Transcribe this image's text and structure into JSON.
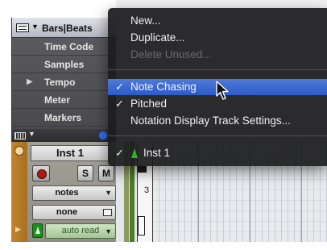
{
  "ruler": {
    "header_label": "Bars|Beats",
    "items": [
      {
        "label": "Time Code",
        "expandable": false
      },
      {
        "label": "Samples",
        "expandable": false
      },
      {
        "label": "Tempo",
        "expandable": true
      },
      {
        "label": "Meter",
        "expandable": false
      },
      {
        "label": "Markers",
        "expandable": false
      }
    ]
  },
  "track": {
    "name": "Inst 1",
    "solo_label": "S",
    "mute_label": "M",
    "view_selector": "notes",
    "playlist_selector": "none",
    "automation_mode": "auto read"
  },
  "timeline": {
    "ruler_number": "3"
  },
  "menu": {
    "items": [
      {
        "label": "New...",
        "checked": false,
        "enabled": true
      },
      {
        "label": "Duplicate...",
        "checked": false,
        "enabled": true
      },
      {
        "label": "Delete Unused...",
        "checked": false,
        "enabled": false
      },
      {
        "label": "Note Chasing",
        "checked": true,
        "enabled": true,
        "highlighted": true
      },
      {
        "label": "Pitched",
        "checked": true,
        "enabled": true
      },
      {
        "label": "Notation Display Track Settings...",
        "checked": false,
        "enabled": true
      },
      {
        "label": "Inst 1",
        "checked": true,
        "enabled": true,
        "icon": "midi-track-icon"
      }
    ],
    "check_glyph": "✓"
  },
  "colors": {
    "menu_bg": "#1c1c1e",
    "menu_highlight": "#3a66d0",
    "track_orange": "#c3862d",
    "auto_read_green": "#a4c496"
  }
}
